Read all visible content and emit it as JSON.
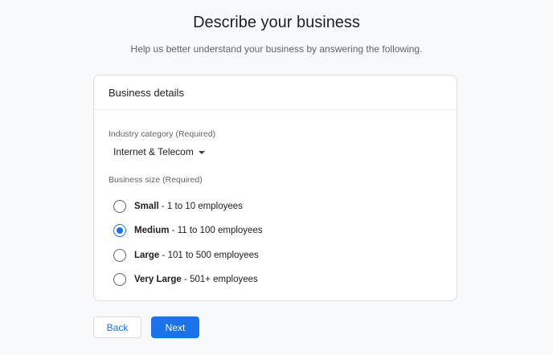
{
  "page": {
    "title": "Describe your business",
    "subtitle": "Help us better understand your business by answering the following."
  },
  "card": {
    "header": "Business details",
    "industry": {
      "label": "Industry category (Required)",
      "selected": "Internet & Telecom"
    },
    "size": {
      "label": "Business size (Required)",
      "options": [
        {
          "name": "Small",
          "range": "1 to 10 employees",
          "checked": false
        },
        {
          "name": "Medium",
          "range": "11 to 100 employees",
          "checked": true
        },
        {
          "name": "Large",
          "range": "101 to 500 employees",
          "checked": false
        },
        {
          "name": "Very Large",
          "range": "501+ employees",
          "checked": false
        }
      ]
    }
  },
  "buttons": {
    "back": "Back",
    "next": "Next"
  },
  "colors": {
    "accent": "#1a73e8",
    "border": "#dadce0",
    "background": "#f8f9fa"
  },
  "icons": {
    "dropdown": "caret-down-icon",
    "radio": "radio-button-icon"
  }
}
